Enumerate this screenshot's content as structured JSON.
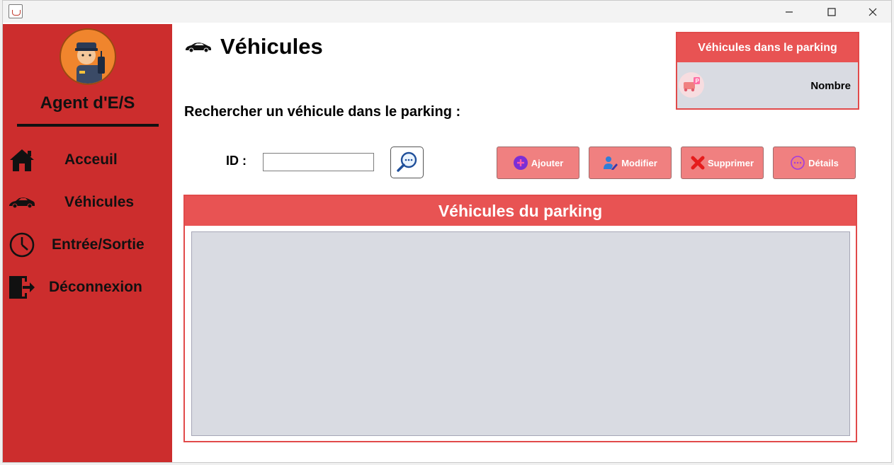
{
  "titlebar": {
    "minimize_icon": "minimize-icon",
    "maximize_icon": "maximize-icon",
    "close_icon": "close-icon"
  },
  "sidebar": {
    "agent_title": "Agent d'E/S",
    "items": [
      {
        "label": "Acceuil",
        "icon": "home-icon"
      },
      {
        "label": "Véhicules",
        "icon": "car-icon"
      },
      {
        "label": "Entrée/Sortie",
        "icon": "clock-icon"
      },
      {
        "label": "Déconnexion",
        "icon": "logout-door-icon"
      }
    ]
  },
  "header": {
    "title": "Véhicules",
    "icon": "car-icon"
  },
  "search": {
    "prompt": "Rechercher un véhicule dans le parking :",
    "id_label": "ID :",
    "id_value": "",
    "search_icon": "magnifier-icon"
  },
  "actions": [
    {
      "label": "Ajouter",
      "icon": "plus-circle-icon"
    },
    {
      "label": "Modifier",
      "icon": "user-edit-icon"
    },
    {
      "label": "Supprimer",
      "icon": "x-mark-icon"
    },
    {
      "label": "Détails",
      "icon": "ellipsis-circle-icon"
    }
  ],
  "counter": {
    "title": "Véhicules dans le parking",
    "label": "Nombre",
    "icon": "parking-car-icon"
  },
  "table": {
    "title": "Véhicules du parking"
  },
  "colors": {
    "sidebar": "#cc2d2d",
    "panel_header": "#e85353",
    "action_button": "#f08080",
    "table_body": "#d9dbe2"
  }
}
